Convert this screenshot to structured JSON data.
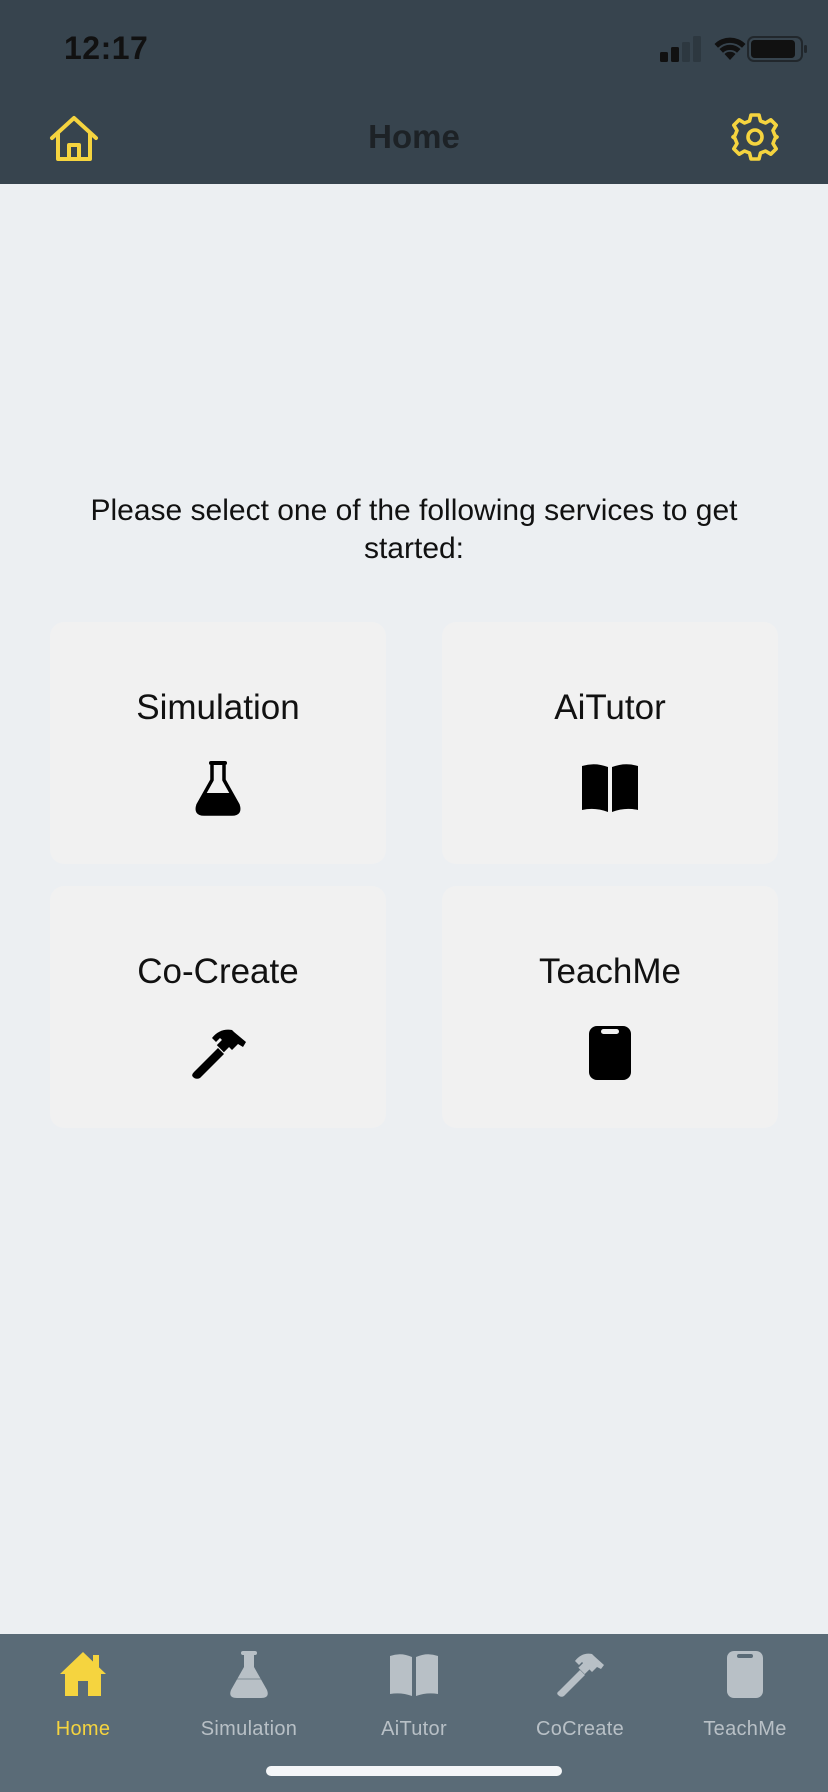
{
  "status_bar": {
    "time": "12:17",
    "icons": [
      "signal-icon",
      "wifi-icon",
      "battery-icon"
    ]
  },
  "nav": {
    "title": "Home",
    "left_icon": "home-icon",
    "right_icon": "gear-icon",
    "icon_color": "#f5d43f",
    "background": "#37444e"
  },
  "main": {
    "prompt": "Please select one of the following services to get started:",
    "cards": [
      {
        "label": "Simulation",
        "icon": "flask-icon"
      },
      {
        "label": "AiTutor",
        "icon": "book-icon"
      },
      {
        "label": "Co-Create",
        "icon": "hammer-icon"
      },
      {
        "label": "TeachMe",
        "icon": "clipboard-icon"
      }
    ]
  },
  "tabs": [
    {
      "label": "Home",
      "icon": "home-icon",
      "active": true
    },
    {
      "label": "Simulation",
      "icon": "flask-icon",
      "active": false
    },
    {
      "label": "AiTutor",
      "icon": "book-icon",
      "active": false
    },
    {
      "label": "CoCreate",
      "icon": "hammer-icon",
      "active": false
    },
    {
      "label": "TeachMe",
      "icon": "clipboard-icon",
      "active": false
    }
  ],
  "colors": {
    "accent": "#f5d43f",
    "tab_bar": "#5a6b77",
    "tab_inactive": "#b8c0c6",
    "page_background": "#eceff2",
    "card_background": "#f1f1f1"
  }
}
